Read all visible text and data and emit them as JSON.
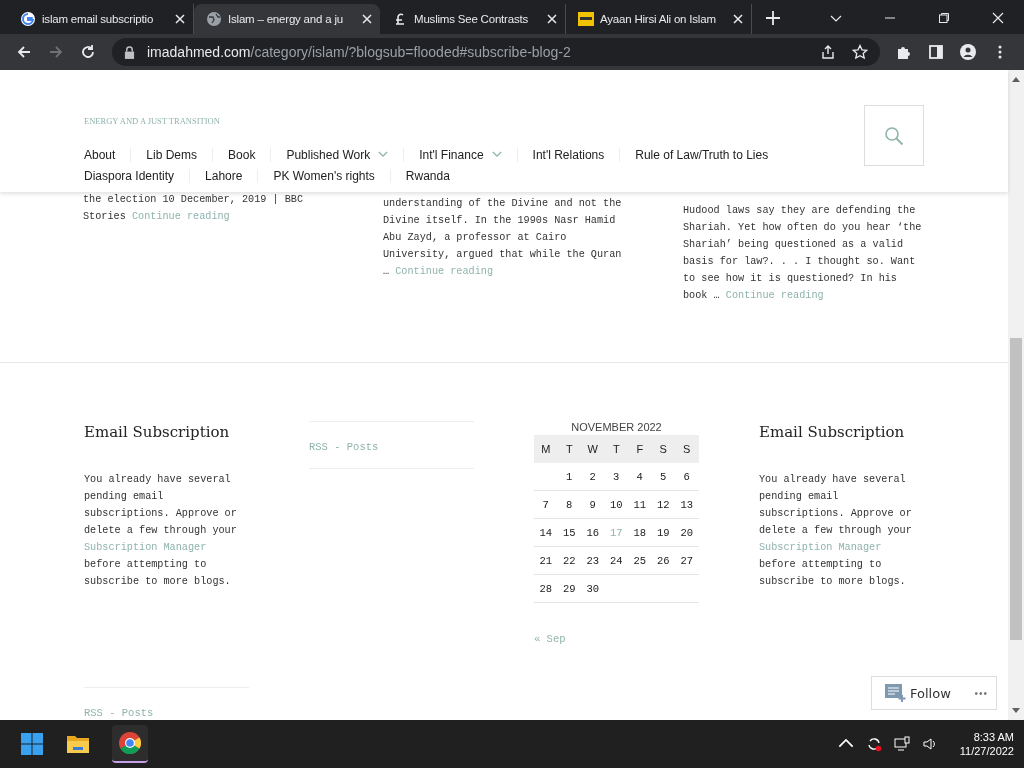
{
  "browser": {
    "tabs": [
      {
        "title": "islam email subscriptio",
        "kind": "google",
        "selected": false
      },
      {
        "title": "Islam – energy and a ju",
        "kind": "globe",
        "selected": true
      },
      {
        "title": "Muslims See Contrasts",
        "kind": "pound",
        "selected": false
      },
      {
        "title": "Ayaan Hirsi Ali on Islam",
        "kind": "yellow",
        "selected": false
      }
    ],
    "url_host": "imadahmed.com",
    "url_path": "/category/islam/?blogsub=flooded#subscribe-blog-2"
  },
  "site": {
    "title": "ENERGY AND A JUST TRANSITION",
    "nav_rows": [
      [
        {
          "label": "About",
          "has_submenu": false
        },
        {
          "label": "Lib Dems",
          "has_submenu": false
        },
        {
          "label": "Book",
          "has_submenu": false
        },
        {
          "label": "Published Work",
          "has_submenu": true
        },
        {
          "label": "Int'l Finance",
          "has_submenu": true
        },
        {
          "label": "Int'l Relations",
          "has_submenu": false
        },
        {
          "label": "Rule of Law/Truth to Lies",
          "has_submenu": false
        }
      ],
      [
        {
          "label": "Diaspora Identity",
          "has_submenu": false
        },
        {
          "label": "Lahore",
          "has_submenu": false
        },
        {
          "label": "PK Women's rights",
          "has_submenu": false
        },
        {
          "label": "Rwanda",
          "has_submenu": false
        }
      ]
    ]
  },
  "posts": [
    {
      "excerpt": "the election 10 December, 2019 | BBC Stories",
      "link": "Continue reading"
    },
    {
      "excerpt": "understanding of the Divine and not the Divine itself. In the 1990s Nasr Hamid Abu Zayd, a professor at Cairo University, argued that while the Quran …",
      "link": "Continue reading"
    },
    {
      "excerpt": "Hudood laws say they are defending the Shariah. Yet how often do you hear ‘the Shariah’ being questioned as a valid basis for law?. . . I thought so. Want to see how it is questioned? In his book …",
      "link": "Continue reading"
    }
  ],
  "footer": {
    "subscription": {
      "heading": "Email Subscription",
      "before": "You already have several pending email subscriptions. Approve or delete a few through your",
      "link": "Subscription Manager",
      "after": "before attempting to subscribe to more blogs."
    },
    "rss": "RSS - Posts",
    "calendar": {
      "caption": "NOVEMBER 2022",
      "weekdays": [
        "M",
        "T",
        "W",
        "T",
        "F",
        "S",
        "S"
      ],
      "weeks": [
        [
          {
            "day": "1",
            "highlighted": false
          },
          {
            "day": "2",
            "highlighted": false
          },
          {
            "day": "3",
            "highlighted": false
          },
          {
            "day": "4",
            "highlighted": false
          },
          {
            "day": "5",
            "highlighted": false
          },
          {
            "day": "6",
            "highlighted": false
          }
        ],
        [
          {
            "day": "7",
            "highlighted": false
          },
          {
            "day": "8",
            "highlighted": false
          },
          {
            "day": "9",
            "highlighted": false
          },
          {
            "day": "10",
            "highlighted": false
          },
          {
            "day": "11",
            "highlighted": false
          },
          {
            "day": "12",
            "highlighted": false
          },
          {
            "day": "13",
            "highlighted": false
          }
        ],
        [
          {
            "day": "14",
            "highlighted": false
          },
          {
            "day": "15",
            "highlighted": false
          },
          {
            "day": "16",
            "highlighted": false
          },
          {
            "day": "17",
            "highlighted": true
          },
          {
            "day": "18",
            "highlighted": false
          },
          {
            "day": "19",
            "highlighted": false
          },
          {
            "day": "20",
            "highlighted": false
          }
        ],
        [
          {
            "day": "21",
            "highlighted": false
          },
          {
            "day": "22",
            "highlighted": false
          },
          {
            "day": "23",
            "highlighted": false
          },
          {
            "day": "24",
            "highlighted": false
          },
          {
            "day": "25",
            "highlighted": false
          },
          {
            "day": "26",
            "highlighted": false
          },
          {
            "day": "27",
            "highlighted": false
          }
        ],
        [
          {
            "day": "28",
            "highlighted": false
          },
          {
            "day": "29",
            "highlighted": false
          },
          {
            "day": "30",
            "highlighted": false
          }
        ]
      ],
      "prev": "« Sep"
    },
    "subscription_2": {
      "heading": "Email Subscription",
      "before": "You already have several pending email subscriptions. Approve or delete a few through your",
      "link": "Subscription Manager",
      "after": "before attempting to subscribe to more blogs."
    },
    "rss_2": "RSS - Posts"
  },
  "follow": {
    "label": "Follow",
    "more": "•••"
  },
  "taskbar": {
    "time": "8:33 AM",
    "date": "11/27/2022"
  }
}
